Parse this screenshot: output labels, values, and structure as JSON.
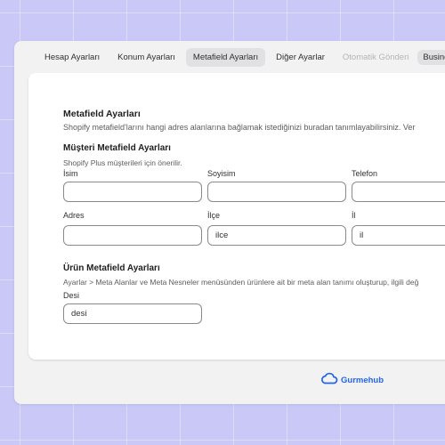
{
  "tabs": [
    {
      "label": "Hesap Ayarları"
    },
    {
      "label": "Konum Ayarları"
    },
    {
      "label": "Metafield Ayarları"
    },
    {
      "label": "Diğer Ayarlar"
    },
    {
      "label": "Otomatik Gönderi"
    },
    {
      "label": "Business"
    }
  ],
  "metafield": {
    "title": "Metafield Ayarları",
    "description": "Shopify metafield'larını hangi adres alanlarına bağlamak istediğinizi buradan tanımlayabilirsiniz. Ver"
  },
  "customer": {
    "title": "Müşteri Metafield Ayarları",
    "hint": "Shopify Plus müşterileri için önerilir.",
    "fields": {
      "isim": {
        "label": "İsim",
        "value": ""
      },
      "soyisim": {
        "label": "Soyisim",
        "value": ""
      },
      "telefon": {
        "label": "Telefon",
        "value": ""
      },
      "adres": {
        "label": "Adres",
        "value": ""
      },
      "ilce": {
        "label": "İlçe",
        "value": "ilce"
      },
      "il": {
        "label": "İl",
        "value": "il"
      }
    }
  },
  "product": {
    "title": "Ürün Metafield Ayarları",
    "description": "Ayarlar > Meta Alanlar ve Meta Nesneler menüsünden ürünlere ait bir meta alan tanımı oluşturup, ilgili değ",
    "fields": {
      "desi": {
        "label": "Desi",
        "value": "desi"
      }
    }
  },
  "footer": {
    "brand": "Gurmehub",
    "icon": "cloud-icon",
    "color": "#2463eb"
  }
}
